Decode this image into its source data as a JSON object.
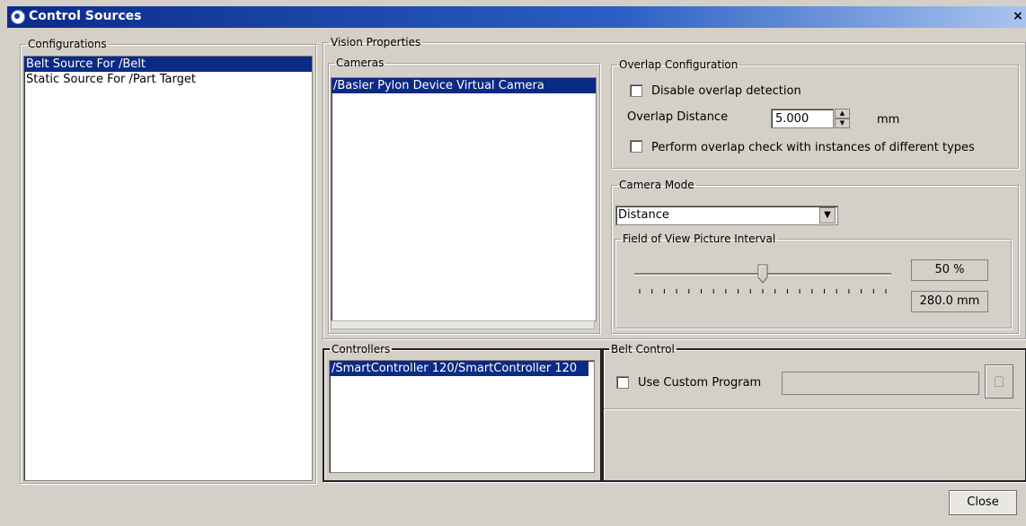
{
  "window": {
    "title": "Control Sources",
    "close_glyph": "×"
  },
  "configurations": {
    "legend": "Configurations",
    "items": [
      {
        "label": "Belt Source For /Belt",
        "selected": true
      },
      {
        "label": "Static Source For /Part Target",
        "selected": false
      }
    ]
  },
  "vision_properties": {
    "legend": "Vision Properties",
    "cameras": {
      "legend": "Cameras",
      "items": [
        {
          "label": "/Basler Pylon Device Virtual Camera",
          "selected": true
        }
      ]
    },
    "overlap": {
      "legend": "Overlap Configuration",
      "disable_label": "Disable overlap detection",
      "disable_checked": false,
      "distance_label": "Overlap Distance",
      "distance_value": "5.000",
      "distance_unit": "mm",
      "different_types_label": "Perform overlap check with instances of different types",
      "different_types_checked": false
    },
    "camera_mode": {
      "legend": "Camera Mode",
      "selected": "Distance",
      "fov": {
        "legend": "Field of View Picture Interval",
        "slider_percent": 50,
        "percent_text": "50 %",
        "distance_text": "280.0 mm"
      }
    }
  },
  "controllers": {
    "legend": "Controllers",
    "items": [
      {
        "label": "/SmartController 120/SmartController 120",
        "selected": true
      }
    ]
  },
  "belt_control": {
    "legend": "Belt Control",
    "custom_program_label": "Use Custom Program",
    "custom_program_checked": false,
    "program_value": ""
  },
  "footer": {
    "close_label": "Close"
  },
  "icons": {
    "app": "app-icon",
    "browse": "browse-icon",
    "dropdown": "chevron-down-icon"
  }
}
